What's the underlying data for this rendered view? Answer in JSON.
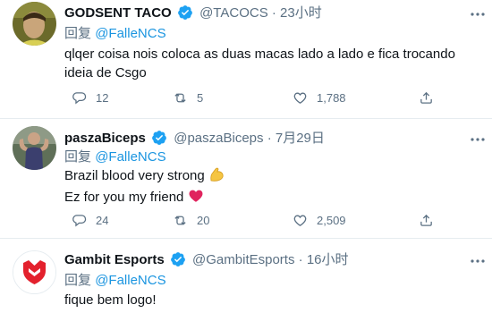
{
  "reply_prefix": "回复",
  "tweets": [
    {
      "name": "GODSENT TACO",
      "handle": "@TACOCS",
      "separator": "·",
      "time": "23小时",
      "reply_to": "@FalleNCS",
      "text": "qlqer coisa nois coloca as duas macas lado a lado e fica trocando ideia de Csgo",
      "replies": "12",
      "retweets": "5",
      "likes": "1,788"
    },
    {
      "name": "paszaBiceps",
      "handle": "@paszaBiceps",
      "separator": "·",
      "time": "7月29日",
      "reply_to": "@FalleNCS",
      "line1": "Brazil blood very strong",
      "line1_emoji": "flexed-biceps",
      "line2": "Ez for you my friend",
      "line2_emoji": "red-heart",
      "replies": "24",
      "retweets": "20",
      "likes": "2,509"
    },
    {
      "name": "Gambit Esports",
      "handle": "@GambitEsports",
      "separator": "·",
      "time": "16小时",
      "reply_to": "@FalleNCS",
      "text": "fique bem logo!"
    }
  ],
  "colors": {
    "mention": "#1b95e0",
    "verified": "#1da1f2",
    "secondary": "#5b7083",
    "heart": "#e0245e",
    "gambit": "#e3212d"
  }
}
